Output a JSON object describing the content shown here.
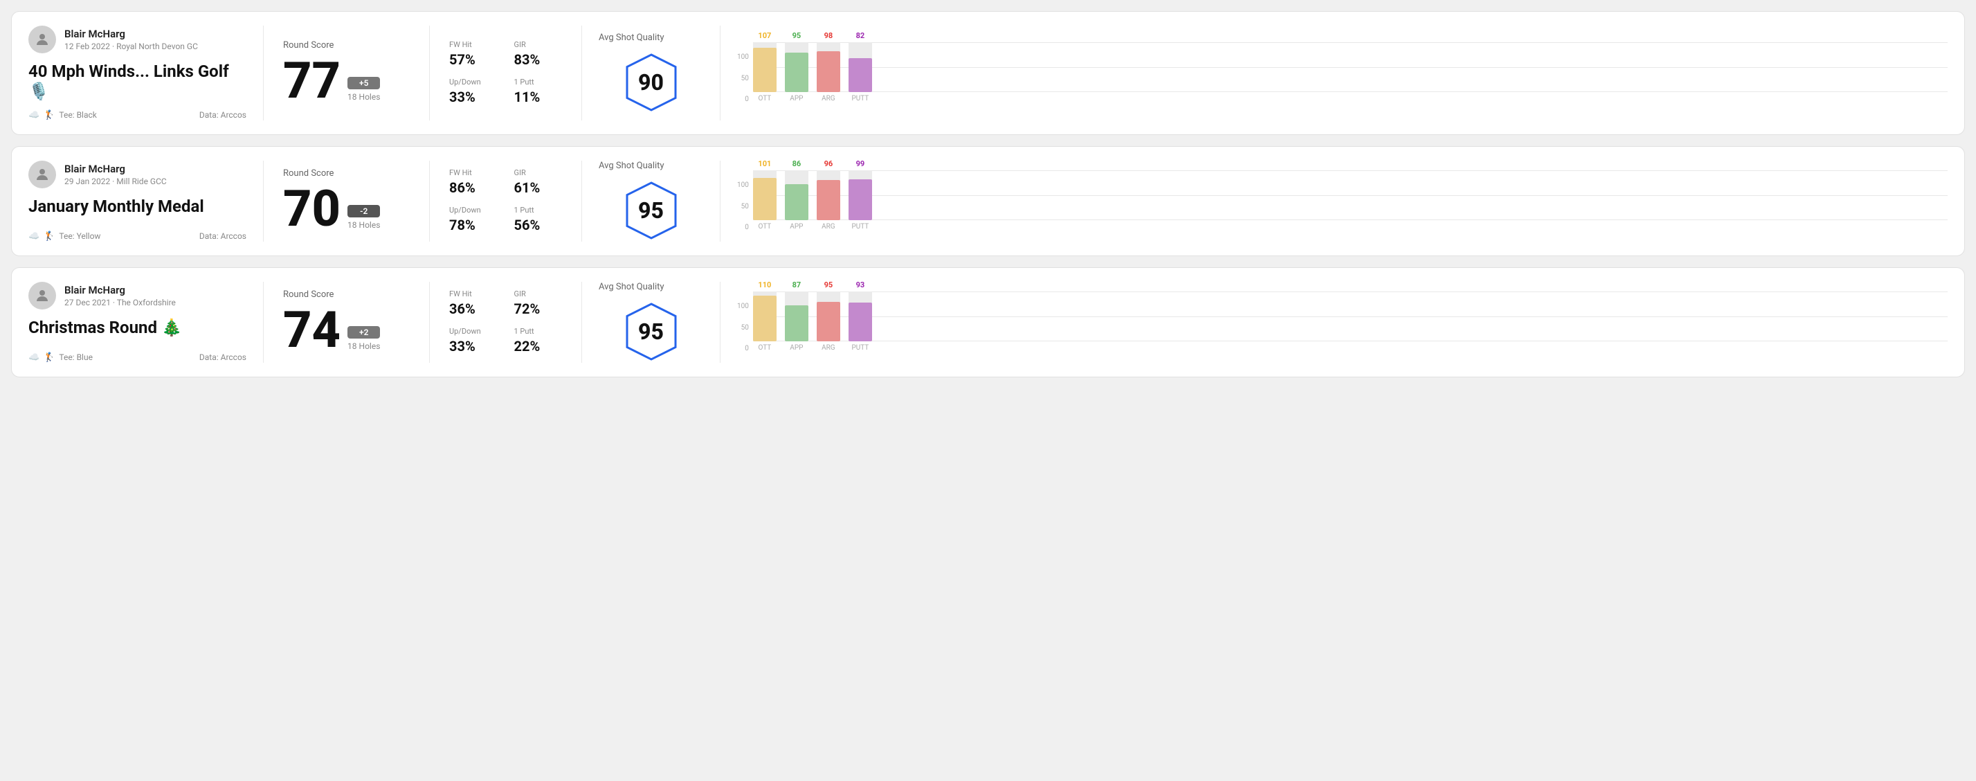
{
  "cards": [
    {
      "id": "card1",
      "user": {
        "name": "Blair McHarg",
        "meta": "12 Feb 2022 · Royal North Devon GC"
      },
      "title": "40 Mph Winds... Links Golf 🎙️",
      "tee": "Tee: Black",
      "data_source": "Data: Arccos",
      "round_score_label": "Round Score",
      "score": "77",
      "score_diff": "+5",
      "holes": "18 Holes",
      "fw_hit_label": "FW Hit",
      "fw_hit": "57%",
      "gir_label": "GIR",
      "gir": "83%",
      "updown_label": "Up/Down",
      "updown": "33%",
      "oneputt_label": "1 Putt",
      "oneputt": "11%",
      "avg_quality_label": "Avg Shot Quality",
      "quality_score": "90",
      "chart": {
        "bars": [
          {
            "label": "OTT",
            "value": 107,
            "color": "#f0b429"
          },
          {
            "label": "APP",
            "value": 95,
            "color": "#4caf50"
          },
          {
            "label": "ARG",
            "value": 98,
            "color": "#e53935"
          },
          {
            "label": "PUTT",
            "value": 82,
            "color": "#9c27b0"
          }
        ],
        "y_labels": [
          "100",
          "50",
          "0"
        ]
      }
    },
    {
      "id": "card2",
      "user": {
        "name": "Blair McHarg",
        "meta": "29 Jan 2022 · Mill Ride GCC"
      },
      "title": "January Monthly Medal",
      "tee": "Tee: Yellow",
      "data_source": "Data: Arccos",
      "round_score_label": "Round Score",
      "score": "70",
      "score_diff": "-2",
      "holes": "18 Holes",
      "fw_hit_label": "FW Hit",
      "fw_hit": "86%",
      "gir_label": "GIR",
      "gir": "61%",
      "updown_label": "Up/Down",
      "updown": "78%",
      "oneputt_label": "1 Putt",
      "oneputt": "56%",
      "avg_quality_label": "Avg Shot Quality",
      "quality_score": "95",
      "chart": {
        "bars": [
          {
            "label": "OTT",
            "value": 101,
            "color": "#f0b429"
          },
          {
            "label": "APP",
            "value": 86,
            "color": "#4caf50"
          },
          {
            "label": "ARG",
            "value": 96,
            "color": "#e53935"
          },
          {
            "label": "PUTT",
            "value": 99,
            "color": "#9c27b0"
          }
        ],
        "y_labels": [
          "100",
          "50",
          "0"
        ]
      }
    },
    {
      "id": "card3",
      "user": {
        "name": "Blair McHarg",
        "meta": "27 Dec 2021 · The Oxfordshire"
      },
      "title": "Christmas Round 🎄",
      "tee": "Tee: Blue",
      "data_source": "Data: Arccos",
      "round_score_label": "Round Score",
      "score": "74",
      "score_diff": "+2",
      "holes": "18 Holes",
      "fw_hit_label": "FW Hit",
      "fw_hit": "36%",
      "gir_label": "GIR",
      "gir": "72%",
      "updown_label": "Up/Down",
      "updown": "33%",
      "oneputt_label": "1 Putt",
      "oneputt": "22%",
      "avg_quality_label": "Avg Shot Quality",
      "quality_score": "95",
      "chart": {
        "bars": [
          {
            "label": "OTT",
            "value": 110,
            "color": "#f0b429"
          },
          {
            "label": "APP",
            "value": 87,
            "color": "#4caf50"
          },
          {
            "label": "ARG",
            "value": 95,
            "color": "#e53935"
          },
          {
            "label": "PUTT",
            "value": 93,
            "color": "#9c27b0"
          }
        ],
        "y_labels": [
          "100",
          "50",
          "0"
        ]
      }
    }
  ]
}
